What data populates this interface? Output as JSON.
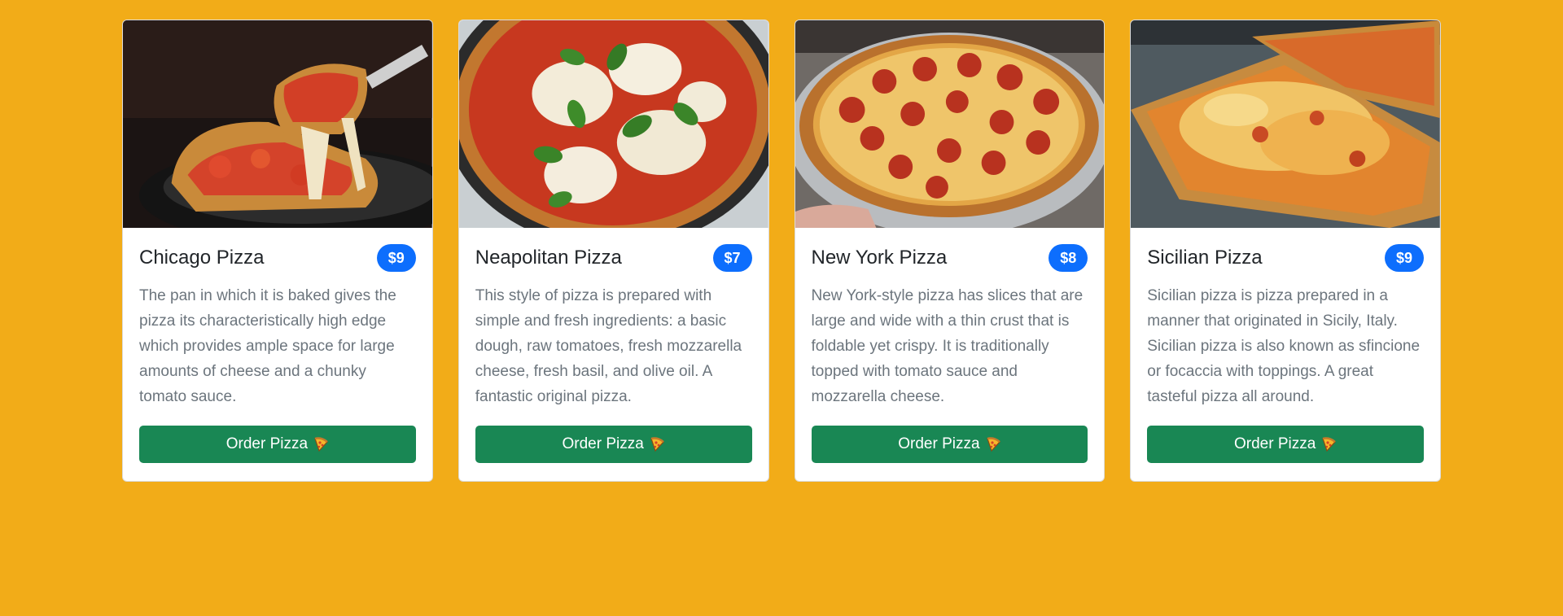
{
  "pizzas": [
    {
      "name": "Chicago Pizza",
      "price": "$9",
      "description": "The pan in which it is baked gives the pizza its characteristically high edge which provides ample space for large amounts of cheese and a chunky tomato sauce.",
      "button_label": "Order Pizza",
      "image_icon": "deep-dish-pizza-photo"
    },
    {
      "name": "Neapolitan Pizza",
      "price": "$7",
      "description": "This style of pizza is prepared with simple and fresh ingredients: a basic dough, raw tomatoes, fresh mozzarella cheese, fresh basil, and olive oil. A fantastic original pizza.",
      "button_label": "Order Pizza",
      "image_icon": "margherita-pizza-photo"
    },
    {
      "name": "New York Pizza",
      "price": "$8",
      "description": "New York-style pizza has slices that are large and wide with a thin crust that is foldable yet crispy. It is traditionally topped with tomato sauce and mozzarella cheese.",
      "button_label": "Order Pizza",
      "image_icon": "pepperoni-pizza-photo"
    },
    {
      "name": "Sicilian Pizza",
      "price": "$9",
      "description": "Sicilian pizza is pizza prepared in a manner that originated in Sicily, Italy. Sicilian pizza is also known as sfincione or focaccia with toppings. A great tasteful pizza all around.",
      "button_label": "Order Pizza",
      "image_icon": "sicilian-pizza-photo"
    }
  ],
  "colors": {
    "background": "#F2AC18",
    "price_badge": "#0D6EFD",
    "order_button": "#198754"
  },
  "button_icon": "pizza-slice-icon"
}
